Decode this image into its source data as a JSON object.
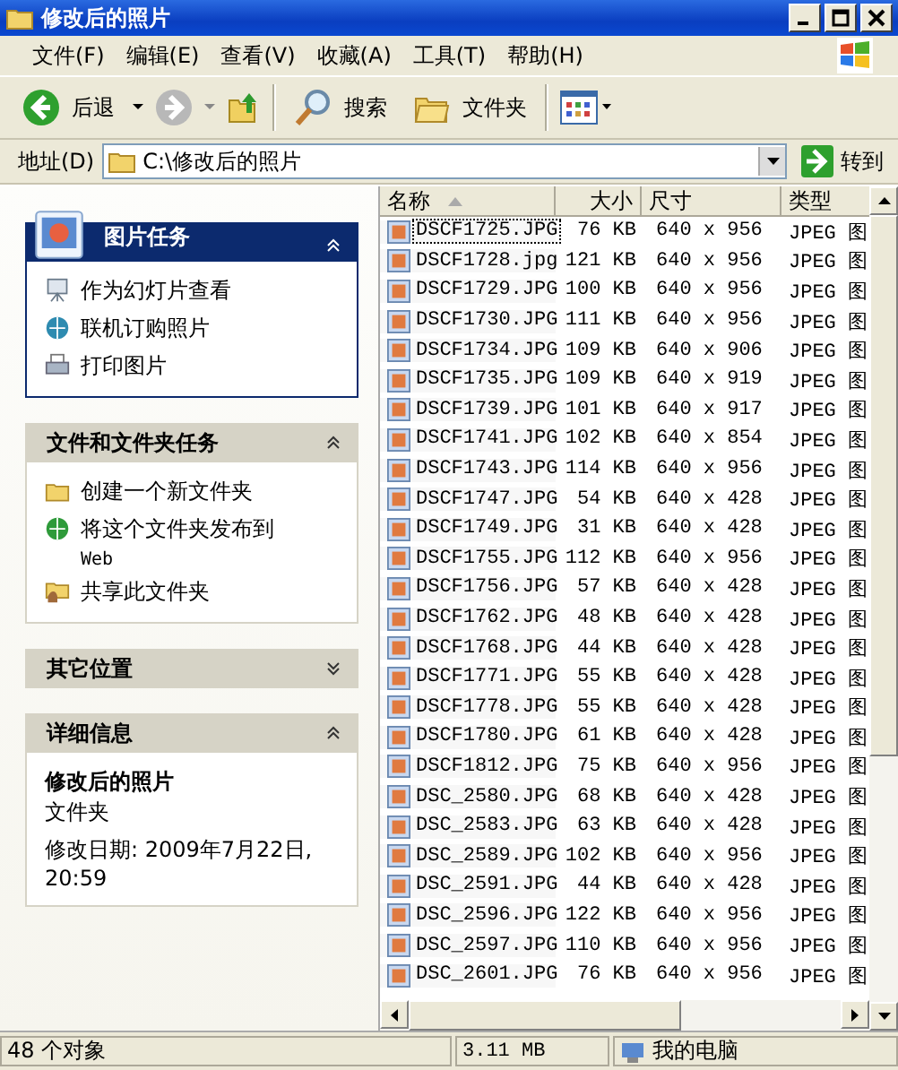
{
  "window": {
    "title": "修改后的照片"
  },
  "menu": [
    "文件(F)",
    "编辑(E)",
    "查看(V)",
    "收藏(A)",
    "工具(T)",
    "帮助(H)"
  ],
  "toolbar": {
    "back": "后退",
    "search": "搜索",
    "folders": "文件夹"
  },
  "address": {
    "label": "地址(D)",
    "value": "C:\\修改后的照片",
    "go": "转到"
  },
  "sidebar": [
    {
      "title": "图片任务",
      "kind": "special",
      "expanded": true,
      "items": [
        {
          "label": "作为幻灯片查看"
        },
        {
          "label": "联机订购照片"
        },
        {
          "label": "打印图片"
        }
      ]
    },
    {
      "title": "文件和文件夹任务",
      "kind": "normal",
      "expanded": true,
      "items": [
        {
          "label": "创建一个新文件夹"
        },
        {
          "label": "将这个文件夹发布到",
          "sub": "Web"
        },
        {
          "label": "共享此文件夹"
        }
      ]
    },
    {
      "title": "其它位置",
      "kind": "normal",
      "expanded": false
    },
    {
      "title": "详细信息",
      "kind": "normal",
      "expanded": true,
      "details": {
        "name": "修改后的照片",
        "type": "文件夹",
        "modified": "修改日期: 2009年7月22日, 20:59"
      }
    }
  ],
  "table": {
    "columns": [
      "名称",
      "大小",
      "尺寸",
      "类型"
    ],
    "rows": [
      {
        "name": "DSCF1725.JPG",
        "size": "76 KB",
        "dims": "640 x 956",
        "type": "JPEG 图",
        "selected": true
      },
      {
        "name": "DSCF1728.jpg",
        "size": "121 KB",
        "dims": "640 x 956",
        "type": "JPEG 图",
        "selected": false
      },
      {
        "name": "DSCF1729.JPG",
        "size": "100 KB",
        "dims": "640 x 956",
        "type": "JPEG 图",
        "selected": false
      },
      {
        "name": "DSCF1730.JPG",
        "size": "111 KB",
        "dims": "640 x 956",
        "type": "JPEG 图",
        "selected": false
      },
      {
        "name": "DSCF1734.JPG",
        "size": "109 KB",
        "dims": "640 x 906",
        "type": "JPEG 图",
        "selected": false
      },
      {
        "name": "DSCF1735.JPG",
        "size": "109 KB",
        "dims": "640 x 919",
        "type": "JPEG 图",
        "selected": false
      },
      {
        "name": "DSCF1739.JPG",
        "size": "101 KB",
        "dims": "640 x 917",
        "type": "JPEG 图",
        "selected": false
      },
      {
        "name": "DSCF1741.JPG",
        "size": "102 KB",
        "dims": "640 x 854",
        "type": "JPEG 图",
        "selected": false
      },
      {
        "name": "DSCF1743.JPG",
        "size": "114 KB",
        "dims": "640 x 956",
        "type": "JPEG 图",
        "selected": false
      },
      {
        "name": "DSCF1747.JPG",
        "size": "54 KB",
        "dims": "640 x 428",
        "type": "JPEG 图",
        "selected": false
      },
      {
        "name": "DSCF1749.JPG",
        "size": "31 KB",
        "dims": "640 x 428",
        "type": "JPEG 图",
        "selected": false
      },
      {
        "name": "DSCF1755.JPG",
        "size": "112 KB",
        "dims": "640 x 956",
        "type": "JPEG 图",
        "selected": false
      },
      {
        "name": "DSCF1756.JPG",
        "size": "57 KB",
        "dims": "640 x 428",
        "type": "JPEG 图",
        "selected": false
      },
      {
        "name": "DSCF1762.JPG",
        "size": "48 KB",
        "dims": "640 x 428",
        "type": "JPEG 图",
        "selected": false
      },
      {
        "name": "DSCF1768.JPG",
        "size": "44 KB",
        "dims": "640 x 428",
        "type": "JPEG 图",
        "selected": false
      },
      {
        "name": "DSCF1771.JPG",
        "size": "55 KB",
        "dims": "640 x 428",
        "type": "JPEG 图",
        "selected": false
      },
      {
        "name": "DSCF1778.JPG",
        "size": "55 KB",
        "dims": "640 x 428",
        "type": "JPEG 图",
        "selected": false
      },
      {
        "name": "DSCF1780.JPG",
        "size": "61 KB",
        "dims": "640 x 428",
        "type": "JPEG 图",
        "selected": false
      },
      {
        "name": "DSCF1812.JPG",
        "size": "75 KB",
        "dims": "640 x 956",
        "type": "JPEG 图",
        "selected": false
      },
      {
        "name": "DSC_2580.JPG",
        "size": "68 KB",
        "dims": "640 x 428",
        "type": "JPEG 图",
        "selected": false
      },
      {
        "name": "DSC_2583.JPG",
        "size": "63 KB",
        "dims": "640 x 428",
        "type": "JPEG 图",
        "selected": false
      },
      {
        "name": "DSC_2589.JPG",
        "size": "102 KB",
        "dims": "640 x 956",
        "type": "JPEG 图",
        "selected": false
      },
      {
        "name": "DSC_2591.JPG",
        "size": "44 KB",
        "dims": "640 x 428",
        "type": "JPEG 图",
        "selected": false
      },
      {
        "name": "DSC_2596.JPG",
        "size": "122 KB",
        "dims": "640 x 956",
        "type": "JPEG 图",
        "selected": false
      },
      {
        "name": "DSC_2597.JPG",
        "size": "110 KB",
        "dims": "640 x 956",
        "type": "JPEG 图",
        "selected": false
      },
      {
        "name": "DSC_2601.JPG",
        "size": "76 KB",
        "dims": "640 x 956",
        "type": "JPEG 图",
        "selected": false
      }
    ]
  },
  "status_bar": {
    "objects": "48 个对象",
    "size": "3.11 MB",
    "location": "我的电脑"
  }
}
